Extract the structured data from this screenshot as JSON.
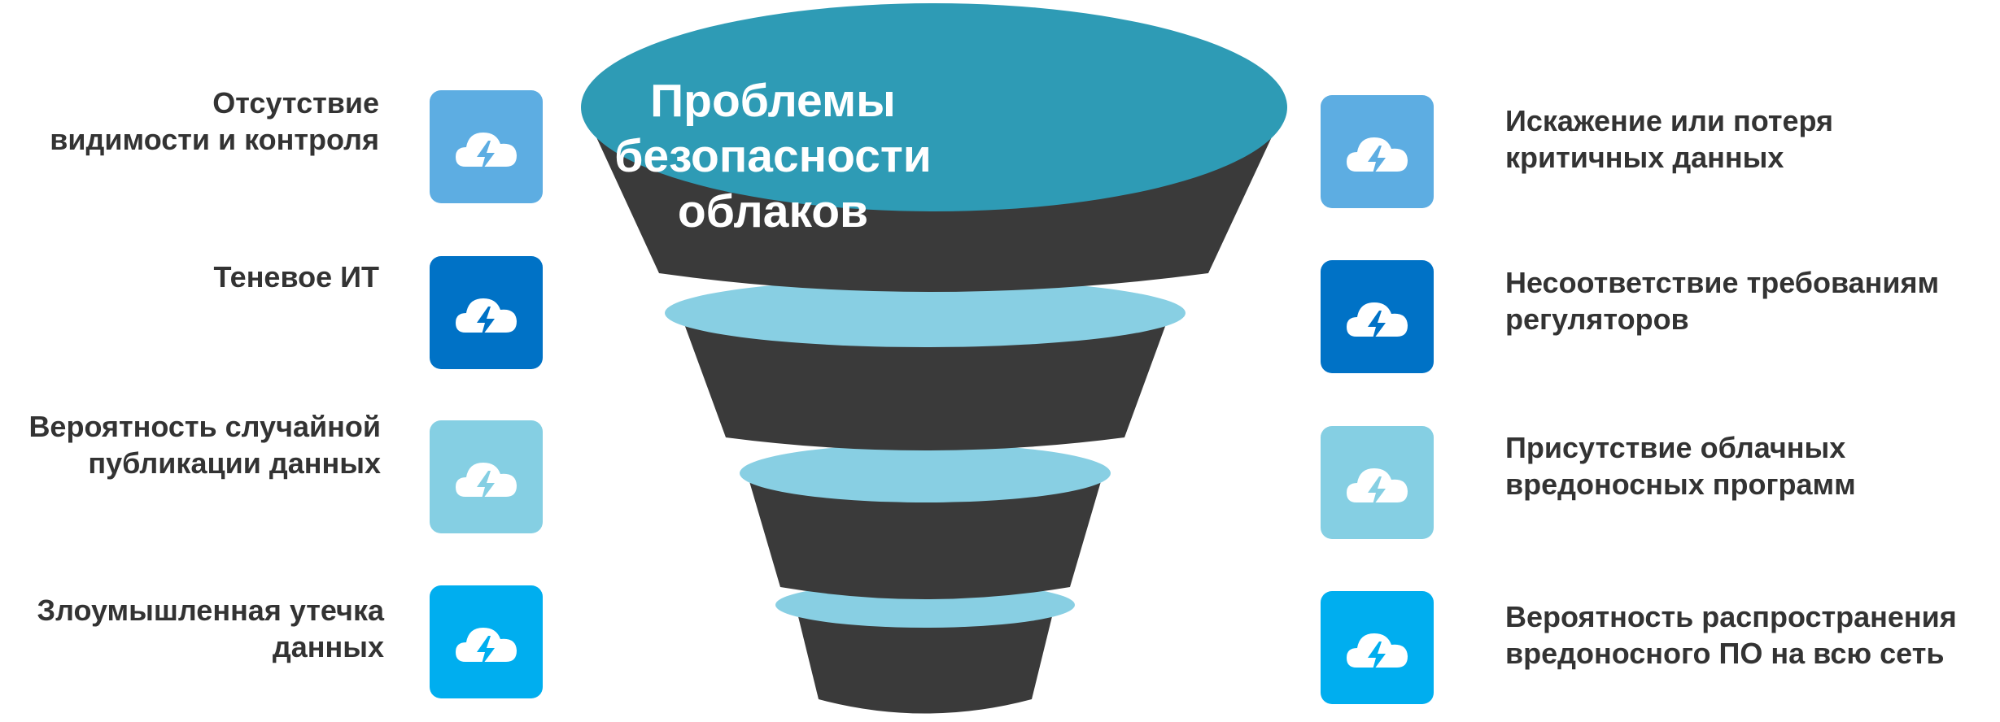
{
  "funnel": {
    "title_line1": "Проблемы безопасности",
    "title_line2": "облаков"
  },
  "left_items": [
    {
      "line1": "Отсутствие",
      "line2": "видимости и контроля",
      "color": "#5DADE2",
      "icon": "cloud-lightning-icon"
    },
    {
      "line1": "Теневое ИТ",
      "line2": "",
      "color": "#0072C6",
      "icon": "cloud-lightning-icon"
    },
    {
      "line1": "Вероятность случайной",
      "line2": "публикации данных",
      "color": "#85CFE3",
      "icon": "cloud-lightning-icon"
    },
    {
      "line1": "Злоумышленная утечка",
      "line2": "данных",
      "color": "#00AEEF",
      "icon": "cloud-lightning-icon"
    }
  ],
  "right_items": [
    {
      "line1": "Искажение или потеря",
      "line2": "критичных данных",
      "color": "#5DADE2",
      "icon": "cloud-lightning-icon"
    },
    {
      "line1": "Несоответствие требованиям",
      "line2": "регуляторов",
      "color": "#0072C6",
      "icon": "cloud-lightning-icon"
    },
    {
      "line1": "Присутствие облачных",
      "line2": "вредоносных программ",
      "color": "#85CFE3",
      "icon": "cloud-lightning-icon"
    },
    {
      "line1": "Вероятность распространения",
      "line2": "вредоносного ПО на всю сеть",
      "color": "#00AEEF",
      "icon": "cloud-lightning-icon"
    }
  ],
  "colors": {
    "funnel_body": "#3A3A3A",
    "funnel_top": "#2E9BB5",
    "funnel_rings": "#88CFE3",
    "text": "#333333"
  }
}
